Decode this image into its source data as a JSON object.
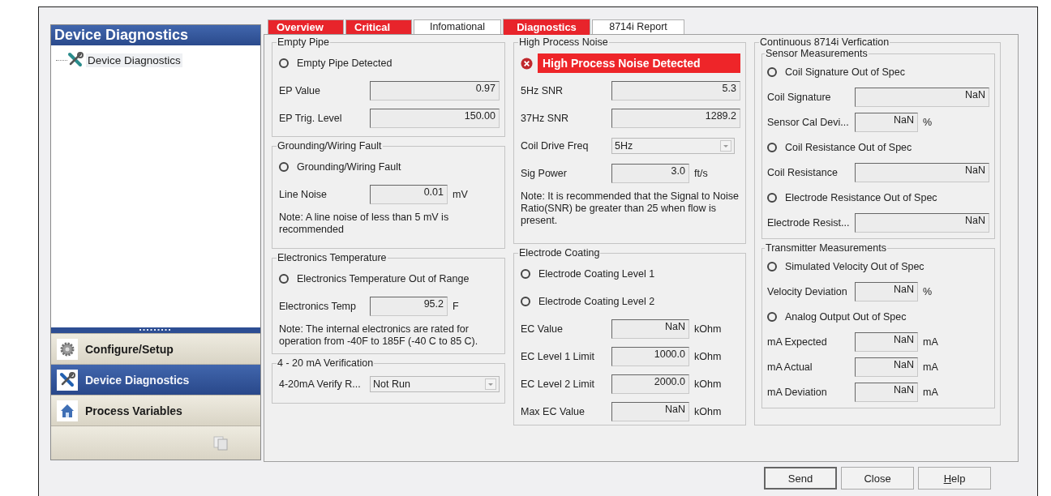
{
  "left_panel": {
    "title": "Device Diagnostics",
    "tree": [
      {
        "label": "Device Diagnostics"
      }
    ],
    "nav": [
      {
        "label": "Configure/Setup",
        "selected": false
      },
      {
        "label": "Device Diagnostics",
        "selected": true
      },
      {
        "label": "Process Variables",
        "selected": false
      }
    ]
  },
  "tabs": [
    {
      "label": "Overview",
      "alert": true,
      "selected": false
    },
    {
      "label": "Critical",
      "alert": true,
      "selected": false
    },
    {
      "label": "Infomational",
      "alert": false,
      "selected": false
    },
    {
      "label": "Diagnostics",
      "alert": true,
      "selected": true
    },
    {
      "label": "8714i Report",
      "alert": false,
      "selected": false
    }
  ],
  "columns": [
    {
      "groups": [
        {
          "title": "Empty Pipe",
          "items": [
            {
              "kind": "radio",
              "label": "Empty Pipe Detected",
              "checked": false
            },
            {
              "kind": "field",
              "label": "EP Value",
              "value": "0.97"
            },
            {
              "kind": "field",
              "label": "EP Trig. Level",
              "value": "150.00"
            }
          ]
        },
        {
          "title": "Grounding/Wiring Fault",
          "items": [
            {
              "kind": "radio",
              "label": "Grounding/Wiring Fault",
              "checked": false
            },
            {
              "kind": "field",
              "label": "Line Noise",
              "value": "0.01",
              "unit": "mV"
            },
            {
              "kind": "note",
              "text": "Note: A line noise of less than 5 mV is recommended"
            }
          ]
        },
        {
          "title": "Electronics Temperature",
          "items": [
            {
              "kind": "radio",
              "label": "Electronics Temperature Out of Range",
              "checked": false
            },
            {
              "kind": "field",
              "label": "Electronics Temp",
              "value": "95.2",
              "unit": "F"
            },
            {
              "kind": "note",
              "text": "Note: The internal electronics are rated for operation from -40F to 185F (-40 C to 85 C)."
            }
          ]
        },
        {
          "title": "4 - 20 mA Verification",
          "items": [
            {
              "kind": "select",
              "label": "4-20mA Verify R...",
              "value": "Not Run"
            }
          ]
        }
      ]
    },
    {
      "groups": [
        {
          "title": "High Process Noise",
          "items": [
            {
              "kind": "alarm",
              "label": "High Process Noise Detected"
            },
            {
              "kind": "field",
              "label": "5Hz SNR",
              "value": "5.3"
            },
            {
              "kind": "field",
              "label": "37Hz SNR",
              "value": "1289.2"
            },
            {
              "kind": "select",
              "label": "Coil Drive Freq",
              "value": "5Hz"
            },
            {
              "kind": "field",
              "label": "Sig Power",
              "value": "3.0",
              "unit": "ft/s"
            },
            {
              "kind": "note",
              "text": "Note: It is recommended that the Signal to Noise Ratio(SNR) be greater than 25 when flow is present."
            }
          ]
        },
        {
          "title": "Electrode Coating",
          "items": [
            {
              "kind": "radio",
              "label": "Electrode Coating Level 1",
              "checked": false
            },
            {
              "kind": "radio",
              "label": "Electrode Coating Level 2",
              "checked": false
            },
            {
              "kind": "field",
              "label": "EC Value",
              "value": "NaN",
              "unit": "kOhm"
            },
            {
              "kind": "field",
              "label": "EC Level 1 Limit",
              "value": "1000.0",
              "unit": "kOhm"
            },
            {
              "kind": "field",
              "label": "EC Level 2 Limit",
              "value": "2000.0",
              "unit": "kOhm"
            },
            {
              "kind": "field",
              "label": "Max EC Value",
              "value": "NaN",
              "unit": "kOhm"
            }
          ]
        }
      ]
    },
    {
      "groups": [
        {
          "title": "Continuous 8714i Verfication",
          "groups": [
            {
              "title": "Sensor Measurements",
              "items": [
                {
                  "kind": "radio",
                  "label": "Coil Signature Out of Spec",
                  "checked": false
                },
                {
                  "kind": "field",
                  "label": "Coil Signature",
                  "value": "NaN"
                },
                {
                  "kind": "field",
                  "label": "Sensor Cal Devi...",
                  "value": "NaN",
                  "unit": "%"
                },
                {
                  "kind": "radio",
                  "label": "Coil Resistance Out of Spec",
                  "checked": false
                },
                {
                  "kind": "field",
                  "label": "Coil Resistance",
                  "value": "NaN"
                },
                {
                  "kind": "radio",
                  "label": "Electrode Resistance Out of Spec",
                  "checked": false
                },
                {
                  "kind": "field",
                  "label": "Electrode Resist...",
                  "value": "NaN"
                }
              ]
            },
            {
              "title": "Transmitter Measurements",
              "items": [
                {
                  "kind": "radio",
                  "label": "Simulated Velocity Out of Spec",
                  "checked": false
                },
                {
                  "kind": "field",
                  "label": "Velocity Deviation",
                  "value": "NaN",
                  "unit": "%"
                },
                {
                  "kind": "radio",
                  "label": "Analog Output Out of Spec",
                  "checked": false
                },
                {
                  "kind": "field",
                  "label": "mA Expected",
                  "value": "NaN",
                  "unit": "mA"
                },
                {
                  "kind": "field",
                  "label": "mA Actual",
                  "value": "NaN",
                  "unit": "mA"
                },
                {
                  "kind": "field",
                  "label": "mA Deviation",
                  "value": "NaN",
                  "unit": "mA"
                }
              ]
            }
          ]
        }
      ]
    }
  ],
  "buttons": [
    {
      "label": "Send",
      "mnemonic": false
    },
    {
      "label": "Close",
      "mnemonic": false
    },
    {
      "label": "Help",
      "mnemonic": true
    }
  ]
}
